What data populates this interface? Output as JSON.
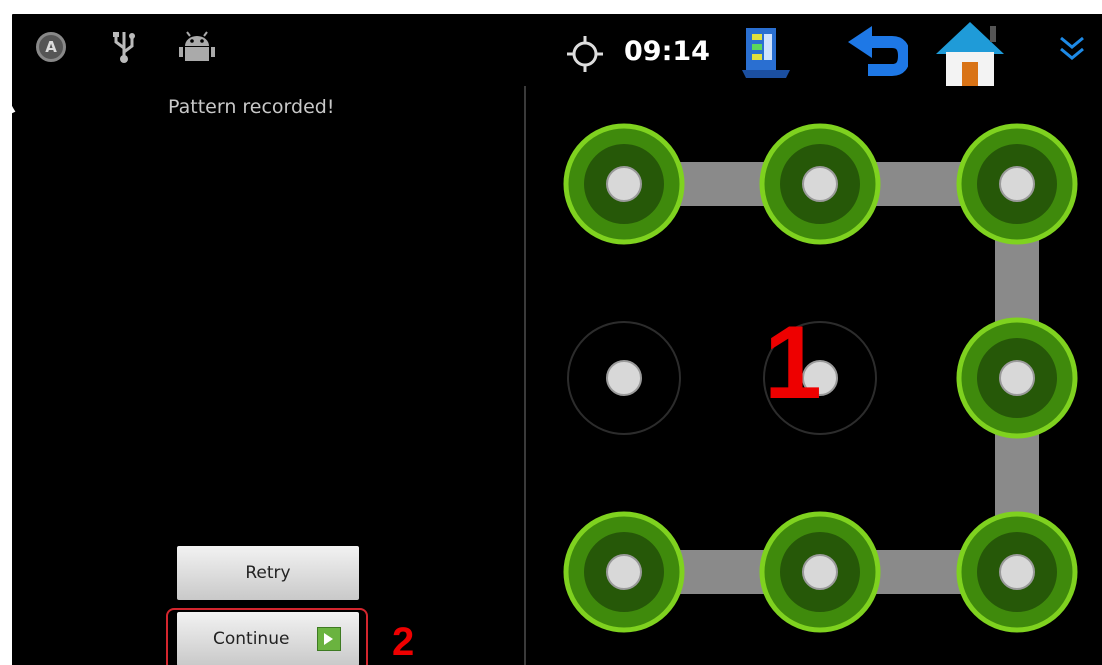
{
  "status_bar": {
    "time": "09:14",
    "icons": [
      "auto-rotate-icon",
      "usb-icon",
      "android-debug-icon",
      "gps-icon",
      "app-icon",
      "back-icon",
      "home-icon",
      "menu-chevron-icon"
    ],
    "icon_a_letter": "A"
  },
  "status_text": "Pattern recorded!",
  "buttons": {
    "retry": "Retry",
    "continue": "Continue"
  },
  "annotations": {
    "pattern_marker": "1",
    "continue_marker": "2"
  },
  "pattern": {
    "grid": 3,
    "selected": [
      0,
      1,
      2,
      5,
      8,
      7,
      6
    ],
    "path": [
      0,
      1,
      2,
      5,
      8,
      7,
      6
    ]
  },
  "colors": {
    "screen_bg": "#000000",
    "selected_ring": "#7fd21f",
    "path": "#8a8a8a",
    "annotation": "#ee0000"
  }
}
